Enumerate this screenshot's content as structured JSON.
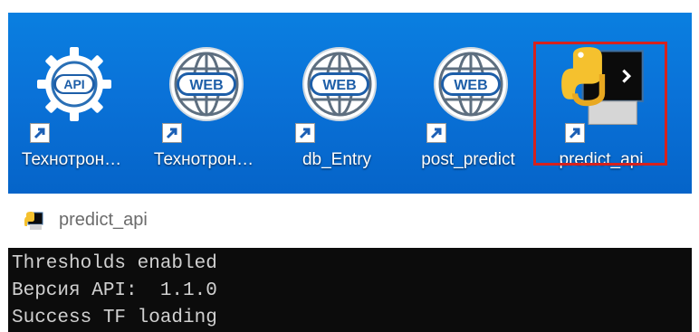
{
  "desktop": {
    "icons": [
      {
        "label": "Технотрон…",
        "icon": "api-gear-icon",
        "badge": "API"
      },
      {
        "label": "Технотрон…",
        "icon": "web-globe-icon",
        "badge": "WEB"
      },
      {
        "label": "db_Entry",
        "icon": "web-globe-icon",
        "badge": "WEB"
      },
      {
        "label": "post_predict",
        "icon": "web-globe-icon",
        "badge": "WEB"
      },
      {
        "label": "predict_api",
        "icon": "python-console-icon",
        "badge": ""
      }
    ],
    "selected": "predict_api",
    "colors": {
      "background": "#0a72d8",
      "selection_border": "#d5221e"
    }
  },
  "console_window": {
    "title": "predict_api",
    "lines": [
      "Thresholds enabled",
      "Версия API:  1.1.0",
      "Success TF loading"
    ]
  }
}
